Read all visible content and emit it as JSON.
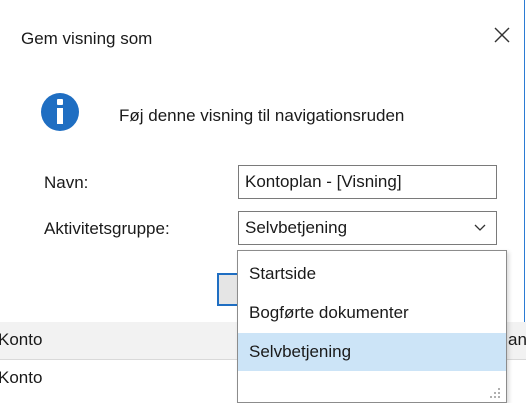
{
  "dialog": {
    "title": "Gem visning som",
    "close_icon": "close-icon",
    "info_icon": "info-icon",
    "info_text": "Føj denne visning til navigationsruden",
    "name_label": "Navn:",
    "name_value": "Kontoplan - [Visning]",
    "group_label": "Aktivitetsgruppe:",
    "group_value": "Selvbetjening"
  },
  "dropdown": {
    "items": [
      {
        "label": "Startside",
        "selected": false
      },
      {
        "label": "Bogførte dokumenter",
        "selected": false
      },
      {
        "label": "Selvbetjening",
        "selected": true
      }
    ]
  },
  "background_list": {
    "rows": [
      {
        "left": "Konto",
        "right": "ang"
      },
      {
        "left": "Konto",
        "right": ""
      }
    ]
  },
  "colors": {
    "accent": "#1f6ec2",
    "selected_bg": "#cce4f7",
    "border": "#7a7a7a"
  }
}
